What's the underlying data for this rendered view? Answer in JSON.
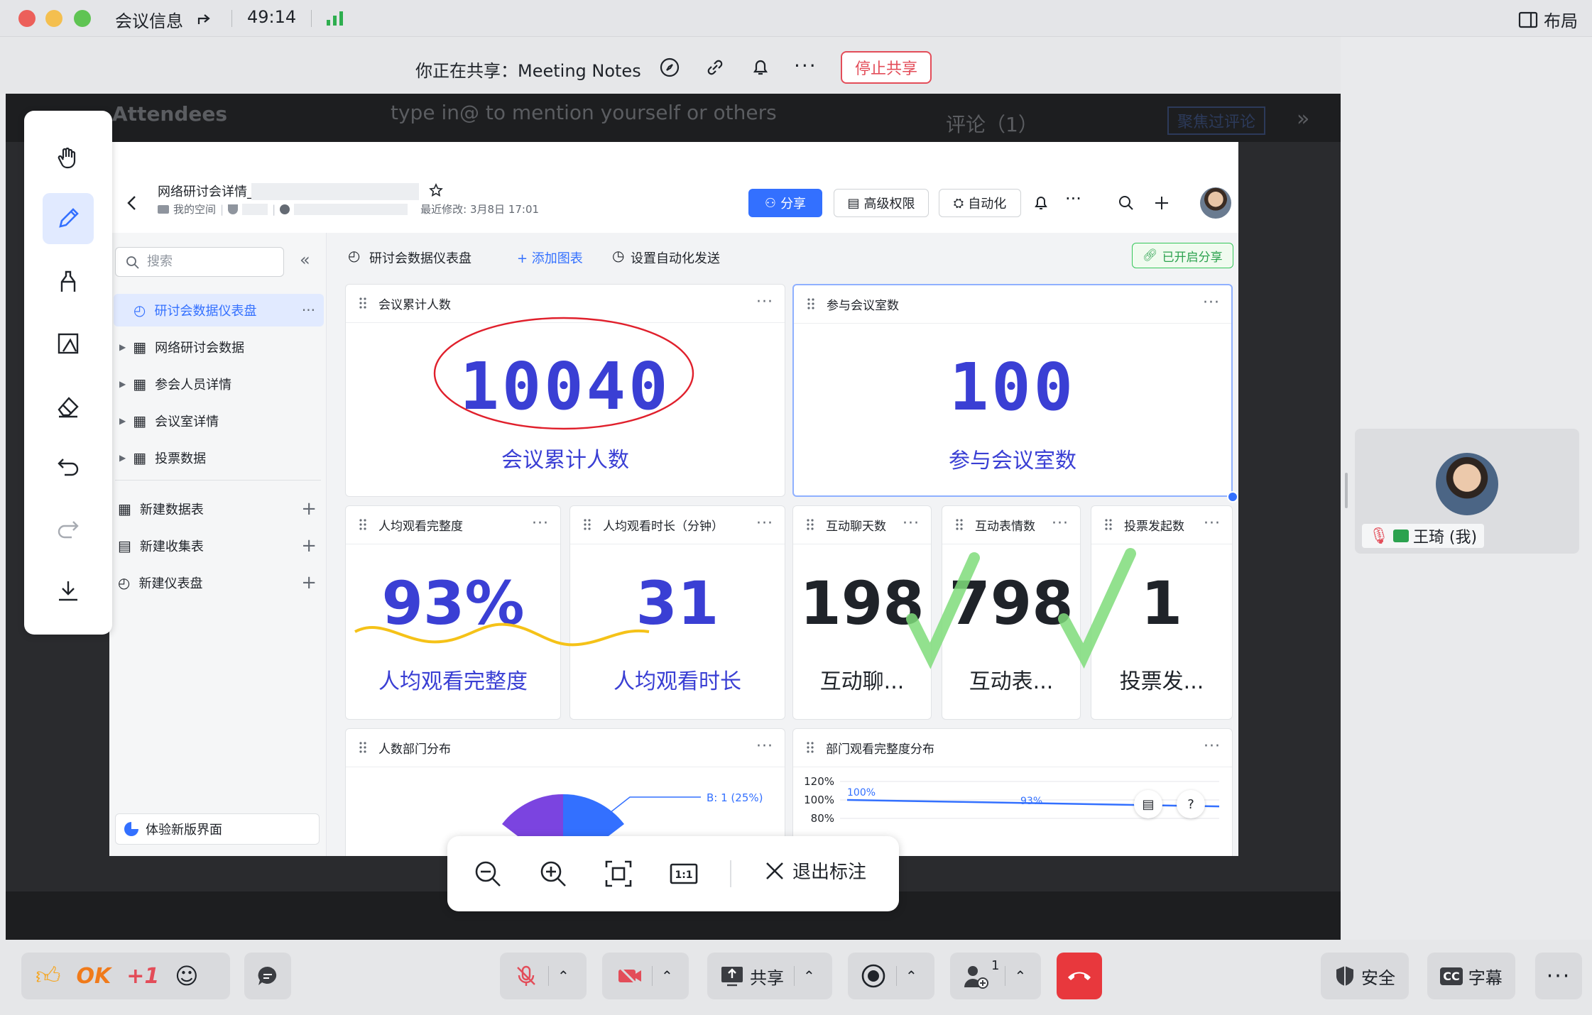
{
  "titlebar": {
    "title": "会议信息",
    "timer": "49:14",
    "layout_label": "布局"
  },
  "sharebar": {
    "label": "你正在共享：Meeting Notes",
    "stop_label": "停止共享"
  },
  "background_doc": {
    "attendees": "Attendees",
    "placeholder": "type in@ to mention yourself or others",
    "comments": "评论（1）",
    "focus_btn": "聚焦过评论"
  },
  "doc": {
    "title": "网络研讨会详情_",
    "space": "我的空间",
    "last_modified": "最近修改: 3月8日 17:01",
    "share_label": "分享",
    "advanced_label": "高级权限",
    "automation_label": "自动化"
  },
  "sidebar": {
    "search_placeholder": "搜索",
    "items": [
      {
        "label": "研讨会数据仪表盘"
      },
      {
        "label": "网络研讨会数据"
      },
      {
        "label": "参会人员详情"
      },
      {
        "label": "会议室详情"
      },
      {
        "label": "投票数据"
      }
    ],
    "new_items": [
      {
        "label": "新建数据表"
      },
      {
        "label": "新建收集表"
      },
      {
        "label": "新建仪表盘"
      }
    ],
    "try_new": "体验新版界面"
  },
  "dashboard": {
    "title": "研讨会数据仪表盘",
    "add_chart": "+ 添加图表",
    "auto_send": "设置自动化发送",
    "shared_badge": "已开启分享",
    "cards": {
      "total_people": {
        "title": "会议累计人数",
        "value": "10040",
        "label": "会议累计人数"
      },
      "rooms": {
        "title": "参与会议室数",
        "value": "100",
        "label": "参与会议室数"
      },
      "completion": {
        "title": "人均观看完整度",
        "value": "93%",
        "label": "人均观看完整度"
      },
      "duration": {
        "title": "人均观看时长（分钟）",
        "value": "31",
        "label": "人均观看时长"
      },
      "chat_days": {
        "title": "互动聊天数",
        "value": "198",
        "label": "互动聊..."
      },
      "reactions": {
        "title": "互动表情数",
        "value": "798",
        "label": "互动表..."
      },
      "votes": {
        "title": "投票发起数",
        "value": "1",
        "label": "投票发..."
      },
      "dept_dist": {
        "title": "人数部门分布",
        "pie_label": "B: 1 (25%)"
      },
      "dept_completion": {
        "title": "部门观看完整度分布"
      }
    }
  },
  "chart_data": {
    "type": "line",
    "title": "部门观看完整度分布",
    "y_ticks": [
      "120%",
      "100%",
      "80%"
    ],
    "series": [
      {
        "values": [
          100,
          93
        ]
      }
    ],
    "data_labels": [
      "100%",
      "93%"
    ]
  },
  "zoombar": {
    "exit_label": "退出标注"
  },
  "participant": {
    "name": "王琦 (我)"
  },
  "bottombar": {
    "ok": "OK",
    "plus_one": "+1",
    "share_label": "共享",
    "participants_count": "1",
    "security_label": "安全",
    "captions_label": "字幕",
    "cc": "CC"
  }
}
